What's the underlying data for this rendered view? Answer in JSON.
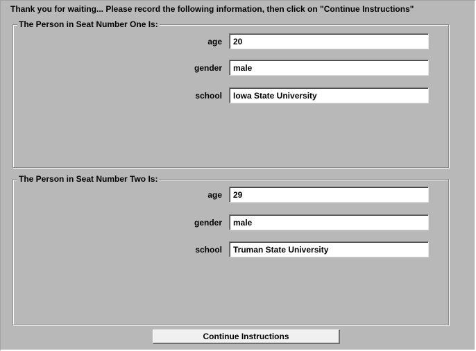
{
  "header": {
    "instructions": "Thank you for waiting... Please record the following information, then click on \"Continue Instructions\""
  },
  "seat_one": {
    "title": "The Person in Seat Number One Is:",
    "age_label": "age",
    "age_value": "20",
    "gender_label": "gender",
    "gender_value": "male",
    "school_label": "school",
    "school_value": "Iowa State University"
  },
  "seat_two": {
    "title": "The Person in Seat Number Two Is:",
    "age_label": "age",
    "age_value": "29",
    "gender_label": "gender",
    "gender_value": "male",
    "school_label": "school",
    "school_value": "Truman State University"
  },
  "footer": {
    "continue_label": "Continue Instructions"
  },
  "colors": {
    "background": "#b8b8b8",
    "input_background": "#ffffff",
    "button_background": "#f0f0f0"
  }
}
